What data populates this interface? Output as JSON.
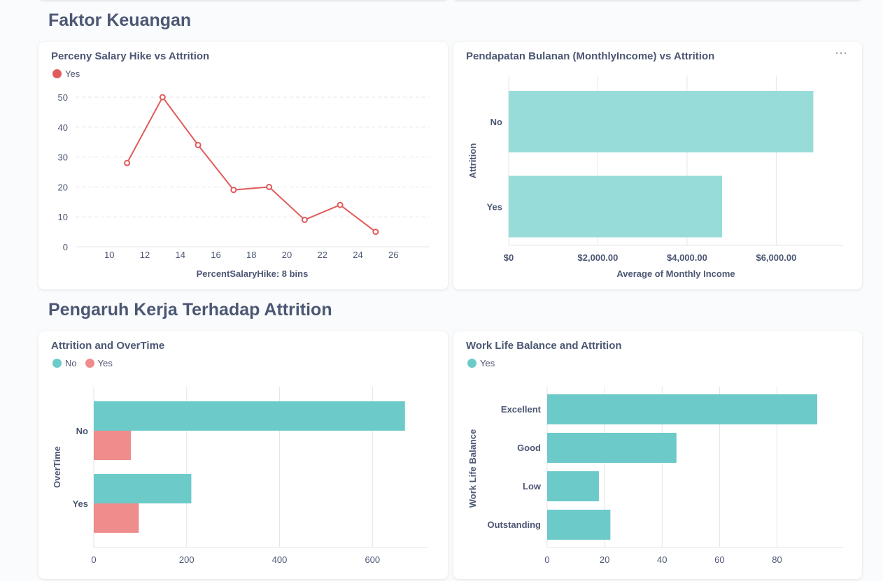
{
  "sections": [
    {
      "title": "Faktor Keuangan"
    },
    {
      "title": "Pengaruh Kerja Terhadap Attrition"
    }
  ],
  "colors": {
    "teal": "#6ccac8",
    "teal_light": "#98dcd9",
    "red": "#e05c5c",
    "salmon": "#ef8c8c"
  },
  "cards": {
    "salary_hike": {
      "title": "Perceny Salary Hike vs Attrition",
      "legend": [
        {
          "label": "Yes",
          "color": "#e05c5c"
        }
      ]
    },
    "monthly_income": {
      "title": "Pendapatan Bulanan (MonthlyIncome) vs Attrition",
      "menu_icon": "more-dots-icon"
    },
    "overtime": {
      "title": "Attrition and OverTime",
      "legend": [
        {
          "label": "No",
          "color": "#6ccac8"
        },
        {
          "label": "Yes",
          "color": "#ef8c8c"
        }
      ]
    },
    "work_life": {
      "title": "Work Life Balance and Attrition",
      "legend": [
        {
          "label": "Yes",
          "color": "#6ccac8"
        }
      ]
    }
  },
  "chart_data": [
    {
      "id": "salary_hike",
      "type": "line",
      "title": "Perceny Salary Hike vs Attrition",
      "xlabel": "PercentSalaryHike: 8 bins",
      "ylabel": "",
      "x": [
        11,
        13,
        15,
        17,
        19,
        21,
        23,
        25
      ],
      "series": [
        {
          "name": "Yes",
          "values": [
            28,
            50,
            34,
            19,
            20,
            9,
            14,
            5
          ]
        }
      ],
      "xticks": [
        10,
        12,
        14,
        16,
        18,
        20,
        22,
        24,
        26
      ],
      "yticks": [
        0,
        10,
        20,
        30,
        40,
        50
      ],
      "xlim": [
        8.1,
        28
      ],
      "ylim": [
        0,
        50
      ],
      "grid": "horizontal dashed",
      "legend": "top-left"
    },
    {
      "id": "monthly_income",
      "type": "bar",
      "orientation": "horizontal",
      "title": "Pendapatan Bulanan (MonthlyIncome) vs Attrition",
      "xlabel": "Average of Monthly Income",
      "ylabel": "Attrition",
      "categories": [
        "No",
        "Yes"
      ],
      "values": [
        6832,
        4787
      ],
      "xticks": [
        0,
        2000,
        4000,
        6000
      ],
      "xtick_labels": [
        "$0",
        "$2,000.00",
        "$4,000.00",
        "$6,000.00"
      ],
      "xlim": [
        0,
        7500
      ],
      "grid": "vertical"
    },
    {
      "id": "overtime",
      "type": "bar",
      "orientation": "horizontal",
      "title": "Attrition and OverTime",
      "xlabel": "",
      "ylabel": "OverTime",
      "categories": [
        "No",
        "Yes"
      ],
      "series": [
        {
          "name": "No",
          "values": [
            670,
            210
          ]
        },
        {
          "name": "Yes",
          "values": [
            80,
            97
          ]
        }
      ],
      "xticks": [
        0,
        200,
        400,
        600
      ],
      "xlim": [
        0,
        720
      ],
      "grid": "vertical",
      "legend": "top-left"
    },
    {
      "id": "work_life",
      "type": "bar",
      "orientation": "horizontal",
      "title": "Work Life Balance and Attrition",
      "xlabel": "",
      "ylabel": "Work Life Balance",
      "categories": [
        "Excellent",
        "Good",
        "Low",
        "Outstanding"
      ],
      "series": [
        {
          "name": "Yes",
          "values": [
            94,
            45,
            18,
            22
          ]
        }
      ],
      "xticks": [
        0,
        20,
        40,
        60,
        80
      ],
      "xlim": [
        0,
        103
      ],
      "grid": "vertical",
      "legend": "top-left"
    }
  ]
}
